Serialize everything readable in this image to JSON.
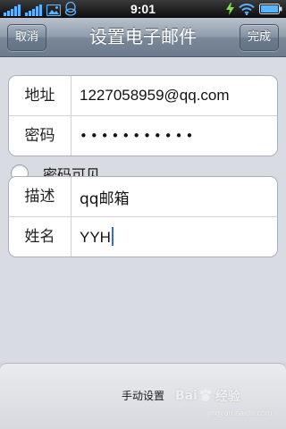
{
  "status_bar": {
    "time": "9:01"
  },
  "nav": {
    "title": "设置电子邮件",
    "cancel_label": "取消",
    "done_label": "完成"
  },
  "account": {
    "address_label": "地址",
    "address_value": "1227058959@qq.com",
    "password_label": "密码",
    "password_value": "•••••••••••"
  },
  "password_toggle": {
    "label": "密码可见"
  },
  "info": {
    "description_label": "描述",
    "description_value": "qq邮箱",
    "name_label": "姓名",
    "name_value": "YYH"
  },
  "bottom": {
    "manual_setup_label": "手动设置"
  },
  "watermark": {
    "brand": "Bai",
    "brand_tail": "经验",
    "url": "jingyan.baidu.com"
  },
  "colors": {
    "nav_gradient_top": "#b9c2cd",
    "nav_gradient_bottom": "#6d7b8e",
    "background": "#d8dce2",
    "cursor": "#3768d8"
  }
}
